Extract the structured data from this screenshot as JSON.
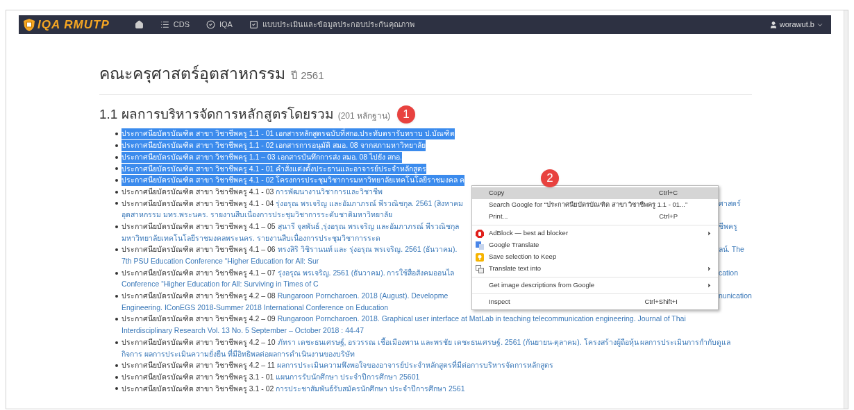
{
  "navbar": {
    "brand": "IQA RMUTP",
    "items": [
      {
        "kind": "home"
      },
      {
        "kind": "list",
        "label": "CDS"
      },
      {
        "kind": "check-circle",
        "label": "IQA"
      },
      {
        "kind": "check-square",
        "label": "แบบประเมินและข้อมูลประกอบประกันคุณภาพ"
      }
    ],
    "user": "worawut.b"
  },
  "page_title": {
    "text": "คณะครุศาสตร์อุตสาหกรรม",
    "year": "ปี 2561"
  },
  "section": {
    "title": "1.1 ผลการบริหารจัดการหลักสูตรโดยรวม",
    "count": "(201 หลักฐาน)",
    "marker": "1"
  },
  "items": [
    {
      "prefix": "ประกาศนียบัตรบัณฑิต สาขา วิชาชีพครู 1.1 - 01",
      "link": "เอกสารหลักสูตรฉบับที่สกอ.ประทับตรารับทราบ ป.บัณฑิต",
      "selected": true
    },
    {
      "prefix": "ประกาศนียบัตรบัณฑิต สาขา วิชาชีพครู 1.1 - 02",
      "link": "เอกสารการอนุมัติ สมอ. 08 จากสภามหาวิทยาลัย",
      "selected": true
    },
    {
      "prefix": "ประกาศนียบัตรบัณฑิต สาขา วิชาชีพครู 1.1 – 03",
      "link": "เอกสารบันทึกการส่ง สมอ. 08 ไปยัง สกอ.",
      "selected": true
    },
    {
      "prefix": "ประกาศนียบัตรบัณฑิต สาขา วิชาชีพครู 4.1 - 01",
      "link": "คำสั่งแต่งตั้งประธานและอาจารย์ประจำหลักสูตร",
      "selected": true
    },
    {
      "prefix": "ประกาศนียบัตรบัณฑิต สาขา วิชาชีพครู 4.1 - 02",
      "link": "โครงการประชุมวิชาการมหาวิทยาลัยเทคโนโลยีราชมงคล ค",
      "selected": true
    },
    {
      "prefix": "ประกาศนียบัตรบัณฑิต สาขา วิชาชีพครู 4.1 - 03",
      "link": "การพัฒนางานวิชาการและวิชาชีพ",
      "selected": false
    },
    {
      "prefix": "ประกาศนียบัตรบัณฑิต สาขา วิชาชีพครู 4.1 - 04",
      "link": "รุ่งอรุณ พรเจริญ และอัมภาภรณ์ พีรวณิชกุล. 2561 (สิงหาคม",
      "tail": "ศาสตร์",
      "continuation": "อุตสาหกรรม มทร.พระนคร. รายงานสืบเนื่องการประชุมวิชาการระดับชาติมหาวิทยาลัย",
      "selected": false
    },
    {
      "prefix": "ประกาศนียบัตรบัณฑิต สาขา วิชาชีพครู 4.1 – 05",
      "link": "สุนารี จุลพันธ์ ,รุ่งอรุณ พรเจริญ และอัมภาภรณ์ พีรวณิชกุล",
      "tail": "ชีพครู",
      "continuation": "มหาวิทยาลัยเทคโนโลยีราชมงคลพระนคร. รายงานสืบเนื่องการประชุมวิชาการระด",
      "selected": false
    },
    {
      "prefix": "ประกาศนียบัตรบัณฑิต สาขา วิชาชีพครู 4.1 – 06",
      "link": "ทรงสิริ วิชิรานนท์ และ รุ่งอรุณ พรเจริญ. 2561 (ธันวาคม).",
      "tail": "ลน์. The",
      "continuation": "7th PSU Education Conference “Higher Education for All: Sur",
      "selected": false
    },
    {
      "prefix": "ประกาศนียบัตรบัณฑิต สาขา วิชาชีพครู 4.1 – 07",
      "link": "รุ่งอรุณ พรเจริญ. 2561 (ธันวาคม). การใช้สื่อสังคมออนไล",
      "tail": "cation",
      "continuation": "Conference “Higher Education for All: Surviving in Times of C",
      "selected": false
    },
    {
      "prefix": "ประกาศนียบัตรบัณฑิต สาขา วิชาชีพครู 4.2 – 08",
      "link": "Rungaroon Porncharoen. 2018 (August). Developme",
      "tail": "nunication",
      "continuation": "Engineering. IConEGS 2018-Summer 2018 International Conference on Education",
      "selected": false
    },
    {
      "prefix": "ประกาศนียบัตรบัณฑิต สาขา วิชาชีพครู 4.2 – 09",
      "link": "Rungaroon Porncharoen. 2018. Graphical user interface at MatLab in teaching telecommunication engineering. Journal of Thai",
      "continuation": "Interdisciplinary Research Vol. 13 No. 5 September – October 2018 : 44-47",
      "selected": false
    },
    {
      "prefix": "ประกาศนียบัตรบัณฑิต สาขา วิชาชีพครู 4.2 – 10",
      "link": "ภัทรา เดชะธนเศรษฐ์, อรวรรณ เชื้อเมืองพาน และพรชัย เดชะธนเศรษฐ์. 2561 (กันยายน-ตุลาคม). โครงสร้างผู้ถือหุ้น ผลการประเมินการกำกับดูแล",
      "continuation": "กิจการ ผลการประเมินความยั่งยืน ที่มีอิทธิพลต่อผลการดำเนินงานของบริษัท",
      "selected": false
    },
    {
      "prefix": "ประกาศนียบัตรบัณฑิต สาขา วิชาชีพครู 4.2 – 11",
      "link": "ผลการประเมินความพึงพอใจของอาจารย์ประจำหลักสูตรที่มีต่อการบริหารจัดการหลักสูตร",
      "selected": false
    },
    {
      "prefix": "ประกาศนียบัตรบัณฑิต สาขา วิชาชีพครู 3.1 - 01",
      "link": "แผนการรับนักศึกษา ประจำปีการศึกษา 25601",
      "selected": false
    },
    {
      "prefix": "ประกาศนียบัตรบัณฑิต สาขา วิชาชีพครู 3.1 - 02",
      "link": "การประชาสัมพันธ์รับสมัครนักศึกษา ประจำปีการศึกษา 2561",
      "selected": false
    }
  ],
  "context_menu": {
    "marker": "2",
    "groups": [
      [
        {
          "label": "Copy",
          "shortcut": "Ctrl+C",
          "selected": true,
          "kind": "plain"
        },
        {
          "label": "Search Google for “ประกาศนียบัตรบัณฑิต สาขา วิชาชีพครู 1.1 - 01...”",
          "selected": false,
          "kind": "plain"
        },
        {
          "label": "Print...",
          "shortcut": "Ctrl+P",
          "selected": false,
          "kind": "plain"
        }
      ],
      [
        {
          "label": "AdBlock — best ad blocker",
          "selected": false,
          "kind": "adblock",
          "submenu": true
        },
        {
          "label": "Google Translate",
          "selected": false,
          "kind": "translate"
        },
        {
          "label": "Save selection to Keep",
          "selected": false,
          "kind": "keep"
        },
        {
          "label": "Translate text into",
          "selected": false,
          "kind": "translate-text",
          "submenu": true
        }
      ],
      [
        {
          "label": "Get image descriptions from Google",
          "selected": false,
          "kind": "plain",
          "submenu": true
        }
      ],
      [
        {
          "label": "Inspect",
          "shortcut": "Ctrl+Shift+I",
          "selected": false,
          "kind": "plain"
        }
      ]
    ]
  }
}
